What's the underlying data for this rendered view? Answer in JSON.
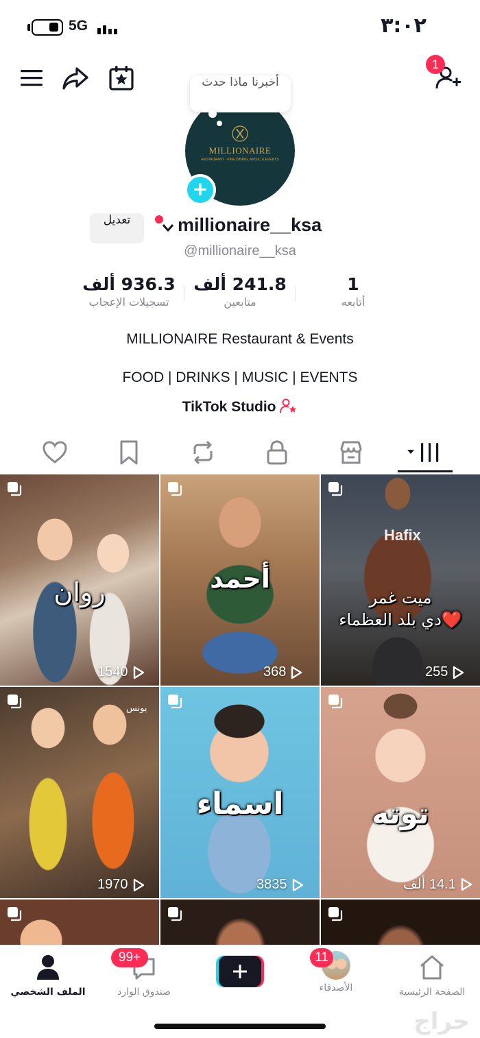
{
  "status_bar": {
    "network": "5G",
    "time": "٣:٠٢"
  },
  "header": {
    "friend_requests_badge": "1"
  },
  "profile": {
    "bubble_text": "أخبرنا ماذا حدث",
    "logo_text": "MILLIONAIRE",
    "logo_sub": "RESTAURANT · FINE DINING, MUSIC & EVENTS",
    "edit_label": "تعديل",
    "display_name": "millionaire__ksa",
    "handle": "@millionaire__ksa",
    "stats": [
      {
        "value": "936.3 ألف",
        "label": "تسجيلات الإعجاب"
      },
      {
        "value": "241.8 ألف",
        "label": "متابعين"
      },
      {
        "value": "1",
        "label": "أتابعه"
      }
    ],
    "bio_line1": "MILLIONAIRE Restaurant & Events",
    "bio_line2": "FOOD | DRINKS | MUSIC | EVENTS",
    "studio_link": "TikTok Studio"
  },
  "tabs": [
    "liked",
    "favorites",
    "reposts",
    "private",
    "shop",
    "videos"
  ],
  "videos": [
    {
      "caption": "روان",
      "views": "1540"
    },
    {
      "caption": "أحمد",
      "views": "368"
    },
    {
      "caption": "ميت غمر\nدي بلد العظماء❤️",
      "overlay": "Hafix",
      "views": "255"
    },
    {
      "caption": "",
      "overlay": "يونس",
      "views": "1970"
    },
    {
      "caption": "اسماء",
      "views": "3835"
    },
    {
      "caption": "توته",
      "views": "14.1 ألف"
    },
    {
      "caption": "",
      "views": ""
    },
    {
      "caption": "",
      "views": ""
    },
    {
      "caption": "",
      "views": ""
    }
  ],
  "bottom_nav": {
    "profile": "الملف الشخصي",
    "inbox": "صندوق الوارد",
    "inbox_badge": "99+",
    "friends": "الأصدقاء",
    "friends_badge": "11",
    "home": "الصفحة الرئيسية"
  },
  "watermark": "حراج",
  "colors": {
    "accent": "#fe2c55",
    "cyan": "#20d5ec",
    "text": "#161823",
    "muted": "#8a8b91"
  }
}
